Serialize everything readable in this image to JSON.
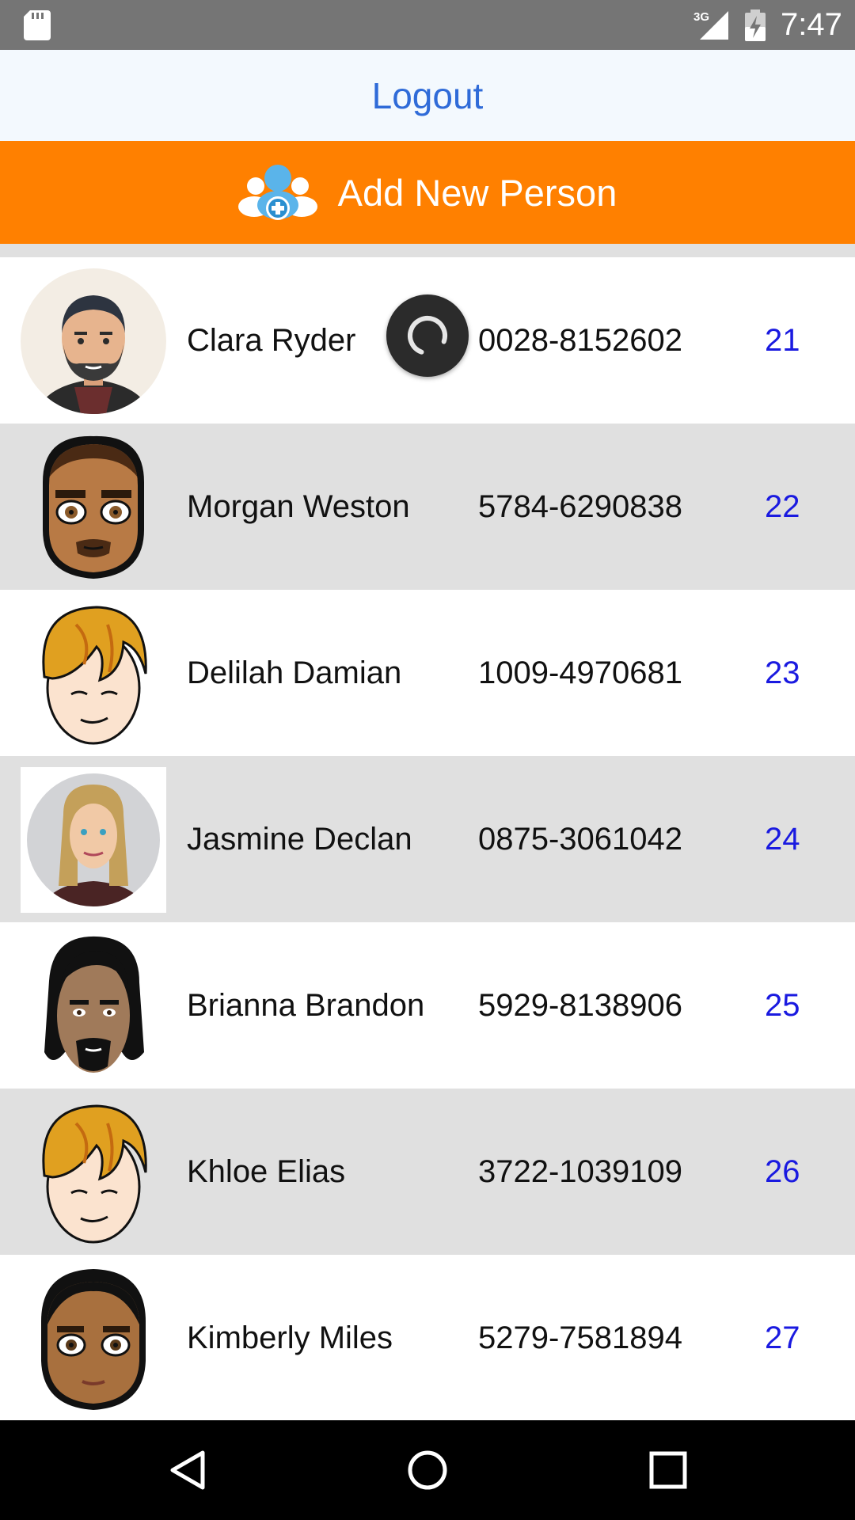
{
  "status_bar": {
    "time": "7:47",
    "network": "3G",
    "icons": [
      "sd-card-icon",
      "signal-icon",
      "battery-charging-icon"
    ]
  },
  "header": {
    "logout_label": "Logout"
  },
  "add_bar": {
    "label": "Add New Person",
    "icon": "add-person-icon",
    "color": "#ff8000"
  },
  "people": [
    {
      "name": "Clara Ryder",
      "phone": "0028-8152602",
      "number": "21",
      "avatar": "bearded-man-avatar"
    },
    {
      "name": "Morgan Weston",
      "phone": "5784-6290838",
      "number": "22",
      "avatar": "goateed-man-avatar"
    },
    {
      "name": "Delilah Damian",
      "phone": "1009-4970681",
      "number": "23",
      "avatar": "blonde-boy-avatar"
    },
    {
      "name": "Jasmine Declan",
      "phone": "0875-3061042",
      "number": "24",
      "avatar": "long-haired-woman-avatar"
    },
    {
      "name": "Brianna Brandon",
      "phone": "5929-8138906",
      "number": "25",
      "avatar": "long-haired-man-avatar"
    },
    {
      "name": "Khloe Elias",
      "phone": "3722-1039109",
      "number": "26",
      "avatar": "blonde-boy-avatar"
    },
    {
      "name": "Kimberly Miles",
      "phone": "5279-7581894",
      "number": "27",
      "avatar": "bald-man-avatar"
    }
  ],
  "loading": true,
  "colors": {
    "status_bar": "#757575",
    "header_bg": "#f3f9fe",
    "logout_text": "#2f6bd8",
    "accent": "#ff8000",
    "row_alt": "#e0e0e0",
    "number_text": "#1a1ae0"
  },
  "nav": {
    "buttons": [
      "back-icon",
      "home-icon",
      "recents-icon"
    ]
  }
}
